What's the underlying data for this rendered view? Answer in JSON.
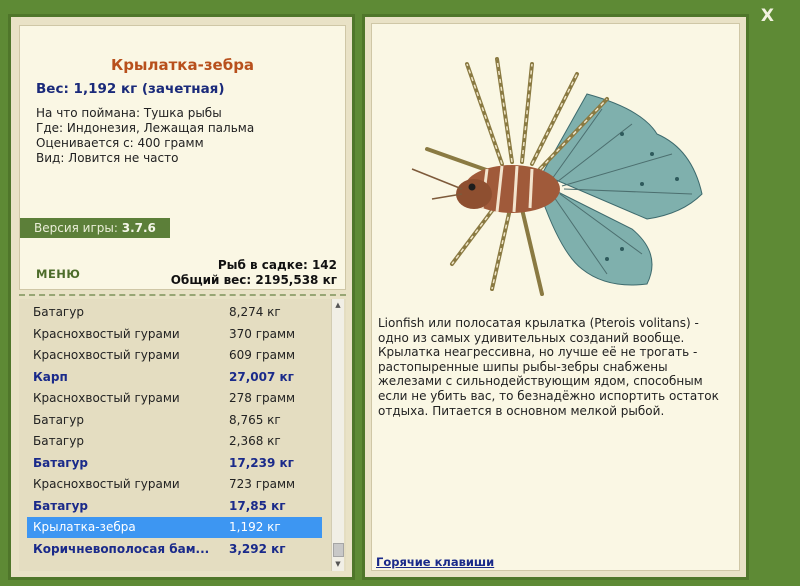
{
  "window": {
    "close_label": "X"
  },
  "fish": {
    "name": "Крылатка-зебра",
    "weight_line": "Вес: 1,192 кг (зачетная)",
    "info": [
      "На что поймана: Тушка рыбы",
      "Где: Индонезия, Лежащая пальма",
      "Оценивается с: 400 грамм",
      "Вид: Ловится не часто"
    ]
  },
  "version": {
    "label": "Версия игры:",
    "value": "3.7.6"
  },
  "menu_label": "МЕНЮ",
  "cage": {
    "count_line": "Рыб в садке: 142",
    "total_line": "Общий вес: 2195,538 кг"
  },
  "catch_list": [
    {
      "name": "Батагур",
      "weight": "8,274 кг",
      "record": false,
      "selected": false
    },
    {
      "name": "Краснохвостый гурами",
      "weight": "370 грамм",
      "record": false,
      "selected": false
    },
    {
      "name": "Краснохвостый гурами",
      "weight": "609 грамм",
      "record": false,
      "selected": false
    },
    {
      "name": "Карп",
      "weight": "27,007 кг",
      "record": true,
      "selected": false
    },
    {
      "name": "Краснохвостый гурами",
      "weight": "278 грамм",
      "record": false,
      "selected": false
    },
    {
      "name": "Батагур",
      "weight": "8,765 кг",
      "record": false,
      "selected": false
    },
    {
      "name": "Батагур",
      "weight": "2,368 кг",
      "record": false,
      "selected": false
    },
    {
      "name": "Батагур",
      "weight": "17,239 кг",
      "record": true,
      "selected": false
    },
    {
      "name": "Краснохвостый гурами",
      "weight": "723 грамм",
      "record": false,
      "selected": false
    },
    {
      "name": "Батагур",
      "weight": "17,85 кг",
      "record": true,
      "selected": false
    },
    {
      "name": "Крылатка-зебра",
      "weight": "1,192 кг",
      "record": false,
      "selected": true
    },
    {
      "name": "Коричневополосая бам...",
      "weight": "3,292 кг",
      "record": true,
      "selected": false
    }
  ],
  "description": "Lionfish или полосатая крылатка (Pterois volitans) - одно из самых удивительных созданий вообще. Крылатка неагрессивна, но лучше её не трогать - растопыренные шипы рыбы-зебры снабжены железами с сильнодействующим ядом, способным если не убить вас, то безнадёжно испортить остаток отдыха. Питается в основном мелкой рыбой.",
  "hotkeys_label": "Горячие клавиши",
  "colors": {
    "background": "#5e8a35",
    "title": "#b8501c",
    "record": "#1a2a8a",
    "selected": "#3d96f2"
  },
  "icons": {
    "close": "close-icon",
    "fish_picture": "lionfish-image"
  }
}
